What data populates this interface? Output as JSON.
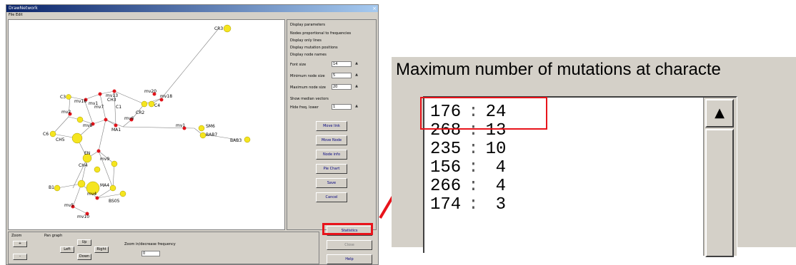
{
  "app": {
    "title": "DrawNetwork",
    "menu": "File  Edit"
  },
  "network": {
    "nodes": [
      {
        "label": "CR3"
      },
      {
        "label": "C3"
      },
      {
        "label": "mv16"
      },
      {
        "label": "mv2"
      },
      {
        "label": "mv1"
      },
      {
        "label": "mv20"
      },
      {
        "label": "mv13"
      },
      {
        "label": "mv18"
      },
      {
        "label": "C6"
      },
      {
        "label": "C4"
      },
      {
        "label": "mv7"
      },
      {
        "label": "CR2"
      },
      {
        "label": "C1"
      },
      {
        "label": "CH5"
      },
      {
        "label": "CH3"
      },
      {
        "label": "mv6"
      },
      {
        "label": "mv8"
      },
      {
        "label": "MA1"
      },
      {
        "label": "mv1"
      },
      {
        "label": "SM6"
      },
      {
        "label": "BAB7"
      },
      {
        "label": "BAB3"
      },
      {
        "label": "EN"
      },
      {
        "label": "CH4"
      },
      {
        "label": "B1"
      },
      {
        "label": "mv5"
      },
      {
        "label": "mv9"
      },
      {
        "label": "MA4"
      },
      {
        "label": "BS05"
      },
      {
        "label": "mv4"
      },
      {
        "label": "mv10"
      }
    ]
  },
  "params": {
    "header": "Display parameters",
    "check1": "Nodes proportional to frequencies",
    "check2": "Display only lines",
    "check3": "Display mutation positions",
    "check4": "Display node names",
    "font_label": "Font size",
    "font_value": "14",
    "minnode_label": "Minimum node size",
    "minnode_value": "5",
    "maxnode_label": "Maximum node size",
    "maxnode_value": "20",
    "check5": "Show median vectors",
    "median_label": "Hide freq. lower",
    "median_value": "1",
    "btn_movelink": "Move link",
    "btn_movenode": "Move Node",
    "btn_nodeinfo": "Node info",
    "btn_pie": "Pie Chart",
    "btn_save": "Save",
    "btn_cancel": "Cancel"
  },
  "bottom": {
    "zoom_label": "Zoom",
    "zoom_in": "+",
    "zoom_out": "-",
    "pan_label": "Pan graph",
    "up": "Up",
    "left": "Left",
    "right": "Right",
    "down": "Down",
    "freq_label": "Zoom in/decrease frequency",
    "freq_value": "0",
    "stats_btn": "Statistics",
    "close_btn": "Close",
    "help_btn": "Help"
  },
  "zoom": {
    "title": "Maximum number of mutations at characte",
    "rows": [
      {
        "pos": "176",
        "sep": ":",
        "count": "24"
      },
      {
        "pos": "268",
        "sep": ":",
        "count": "13"
      },
      {
        "pos": "235",
        "sep": ":",
        "count": "10"
      },
      {
        "pos": "156",
        "sep": ":",
        "count": "4"
      },
      {
        "pos": "266",
        "sep": ":",
        "count": "4"
      },
      {
        "pos": "174",
        "sep": ":",
        "count": "3"
      }
    ]
  },
  "colors": {
    "window_bg": "#d4d0c8",
    "highlight": "#e8141b",
    "node_yellow": "#f5e51f",
    "node_red": "#e0141b"
  }
}
